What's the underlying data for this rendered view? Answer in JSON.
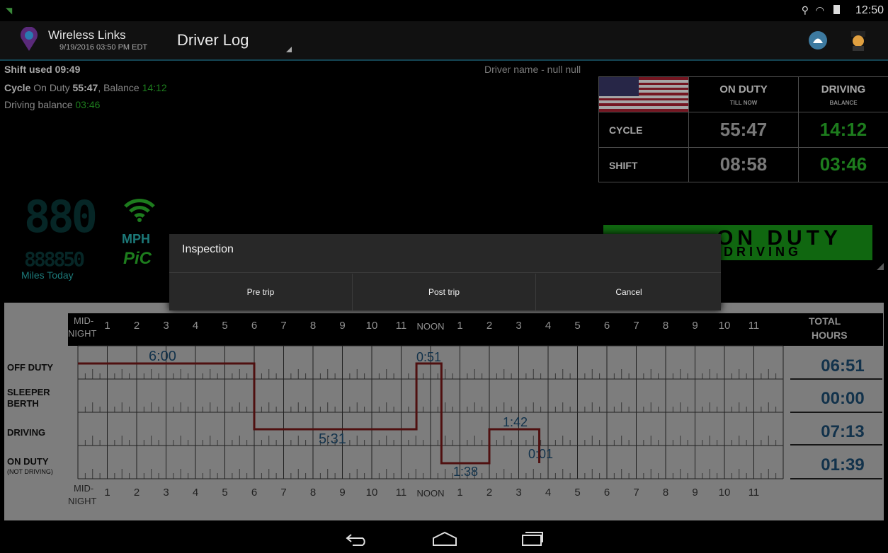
{
  "status_bar": {
    "time": "12:50"
  },
  "app": {
    "name": "Wireless Links",
    "timestamp": "9/19/2016 03:50 PM EDT",
    "screen_title": "Driver Log"
  },
  "info": {
    "shift_used_label": "Shift used",
    "shift_used_value": "09:49",
    "cycle_label": "Cycle",
    "cycle_on_duty_label": "On Duty",
    "cycle_on_duty_value": "55:47",
    "cycle_balance_label": ", Balance",
    "cycle_balance_value": "14:12",
    "driving_balance_label": "Driving balance",
    "driving_balance_value": "03:46",
    "driver_name": "Driver name - null null"
  },
  "summary": {
    "col1_header": "ON DUTY",
    "col1_sub": "TILL NOW",
    "col2_header": "DRIVING",
    "col2_sub": "BALANCE",
    "rows": [
      {
        "label": "CYCLE",
        "on_duty": "55:47",
        "driving": "14:12"
      },
      {
        "label": "SHIFT",
        "on_duty": "08:58",
        "driving": "03:46"
      }
    ]
  },
  "speed_panel": {
    "digits": "880",
    "unit": "MPH",
    "small_digits": "888850",
    "pic": "PiC",
    "miles_today_label": "Miles Today"
  },
  "banner": {
    "line1": "ON DUTY",
    "line2": "DRIVING"
  },
  "dialog": {
    "title": "Inspection",
    "buttons": [
      "Pre trip",
      "Post trip",
      "Cancel"
    ]
  },
  "log": {
    "midnight_top": "MID-",
    "midnight_bottom": "NIGHT",
    "hours": [
      "1",
      "2",
      "3",
      "4",
      "5",
      "6",
      "7",
      "8",
      "9",
      "10",
      "11",
      "NOON",
      "1",
      "2",
      "3",
      "4",
      "5",
      "6",
      "7",
      "8",
      "9",
      "10",
      "11"
    ],
    "total_header_1": "TOTAL",
    "total_header_2": "HOURS",
    "rows": [
      {
        "label": "OFF DUTY",
        "sub": "",
        "total": "06:51"
      },
      {
        "label": "SLEEPER",
        "sub": "BERTH",
        "total": "00:00"
      },
      {
        "label": "DRIVING",
        "sub": "",
        "total": "07:13"
      },
      {
        "label": "ON DUTY",
        "sub": "(NOT DRIVING)",
        "total": "01:39"
      }
    ],
    "segment_labels": [
      "6:00",
      "0:51",
      "5:31",
      "1:42",
      "0:01",
      "1:38"
    ]
  },
  "colors": {
    "accent": "#1f6a80",
    "green": "#2dbf2d",
    "total_blue": "#1d4e74",
    "log_line": "#7a1a1a"
  }
}
